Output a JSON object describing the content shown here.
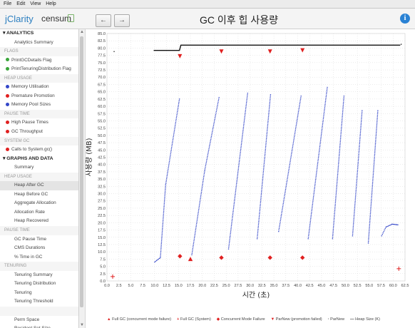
{
  "menu": [
    "File",
    "Edit",
    "View",
    "Help"
  ],
  "brand": {
    "left": "jClarity",
    "right": "censum"
  },
  "nav": {
    "back": "←",
    "forward": "→"
  },
  "title": "GC 이후 힙 사용량",
  "info_icon": "i",
  "colors": {
    "accent": "#2c7fc0",
    "red": "#e02020",
    "blue": "#3346c8",
    "green": "#3aa53a"
  },
  "sidebar": [
    {
      "kind": "section",
      "label": "▾ ANALYTICS"
    },
    {
      "kind": "item",
      "label": "Analytics Summary"
    },
    {
      "kind": "group",
      "label": "FLAGS"
    },
    {
      "kind": "check",
      "label": "PrintGCDetails Flag",
      "status": "green"
    },
    {
      "kind": "check",
      "label": "PrintTenuringDistribution Flag",
      "status": "green"
    },
    {
      "kind": "group",
      "label": "HEAP USAGE"
    },
    {
      "kind": "check",
      "label": "Memory Utilisation",
      "status": "blue"
    },
    {
      "kind": "check",
      "label": "Premature Promotion",
      "status": "red"
    },
    {
      "kind": "check",
      "label": "Memory Pool Sizes",
      "status": "blue"
    },
    {
      "kind": "group",
      "label": "PAUSE TIME"
    },
    {
      "kind": "check",
      "label": "High Pause Times",
      "status": "red"
    },
    {
      "kind": "check",
      "label": "GC Throughput",
      "status": "red"
    },
    {
      "kind": "group",
      "label": "SYSTEM GC"
    },
    {
      "kind": "check",
      "label": "Calls to System.gc()",
      "status": "red"
    },
    {
      "kind": "section",
      "label": "▾ GRAPHS AND DATA"
    },
    {
      "kind": "item",
      "label": "Summary"
    },
    {
      "kind": "group",
      "label": "HEAP USAGE"
    },
    {
      "kind": "item",
      "label": "Heap After GC",
      "active": true
    },
    {
      "kind": "item",
      "label": "Heap Before GC"
    },
    {
      "kind": "item",
      "label": "Aggregate Allocation"
    },
    {
      "kind": "item",
      "label": "Allocation Rate"
    },
    {
      "kind": "item",
      "label": "Heap Recovered"
    },
    {
      "kind": "group",
      "label": "PAUSE TIME"
    },
    {
      "kind": "item",
      "label": "GC Pause Time"
    },
    {
      "kind": "item",
      "label": "CMS Durations"
    },
    {
      "kind": "item",
      "label": "% Time in GC"
    },
    {
      "kind": "group",
      "label": "TENURING"
    },
    {
      "kind": "item",
      "label": "Tenuring Summary"
    },
    {
      "kind": "item",
      "label": "Tenuring Distribution"
    },
    {
      "kind": "item",
      "label": "Tenuring"
    },
    {
      "kind": "item",
      "label": "Tenuring Threshold"
    },
    {
      "kind": "group",
      "label": ""
    },
    {
      "kind": "item",
      "label": "Perm Space"
    },
    {
      "kind": "item",
      "label": "Resident Set Size"
    }
  ],
  "legend": [
    {
      "marker": "▲",
      "text": "Full GC (concurrent mode failure)",
      "color": "red"
    },
    {
      "marker": "+",
      "text": "Full GC (System)",
      "color": "red"
    },
    {
      "marker": "◆",
      "text": "Concurrent Mode Failure",
      "color": "red"
    },
    {
      "marker": "▼",
      "text": "ParNew (promotion failed)",
      "color": "red"
    },
    {
      "marker": "·",
      "text": "ParNew",
      "color": "black"
    },
    {
      "marker": "—",
      "text": "Heap Size (K)",
      "color": "black"
    }
  ],
  "chart_data": {
    "type": "scatter",
    "xlabel": "시간 (초)",
    "ylabel": "사용량 (MB)",
    "xlim": [
      0,
      62.5
    ],
    "ylim": [
      0,
      85
    ],
    "xticks": [
      "0.0",
      "2.5",
      "5.0",
      "7.5",
      "10.0",
      "12.5",
      "15.0",
      "17.5",
      "20.0",
      "22.5",
      "25.0",
      "27.5",
      "30.0",
      "32.5",
      "35.0",
      "37.5",
      "40.0",
      "42.5",
      "45.0",
      "47.5",
      "50.0",
      "52.5",
      "55.0",
      "57.5",
      "60.0",
      "62.5"
    ],
    "yticks": [
      "0.0",
      "2.5",
      "5.0",
      "7.5",
      "10.0",
      "12.5",
      "15.0",
      "17.5",
      "20.0",
      "22.5",
      "25.0",
      "27.5",
      "30.0",
      "32.5",
      "35.0",
      "37.5",
      "40.0",
      "42.5",
      "45.0",
      "47.5",
      "50.0",
      "52.5",
      "55.0",
      "57.5",
      "60.0",
      "62.5",
      "65.0",
      "67.5",
      "70.0",
      "72.5",
      "75.0",
      "77.5",
      "80.0",
      "82.5",
      "85.0"
    ],
    "heap_size_line": [
      [
        9.8,
        79.2
      ],
      [
        15.2,
        79.2
      ],
      [
        15.5,
        81.0
      ],
      [
        61.5,
        81.0
      ]
    ],
    "parnew_segments": [
      [
        10.0,
        6.5,
        11.2,
        8.0
      ],
      [
        11.2,
        8.0,
        12.3,
        33.0
      ],
      [
        12.3,
        33.0,
        15.2,
        62.5
      ],
      [
        17.8,
        9.0,
        20.5,
        38.0
      ],
      [
        20.5,
        38.0,
        23.5,
        63.0
      ],
      [
        25.5,
        11.0,
        29.5,
        64.5
      ],
      [
        31.5,
        14.5,
        34.3,
        64.0
      ],
      [
        36.0,
        17.0,
        40.7,
        63.5
      ],
      [
        42.2,
        14.5,
        46.2,
        66.5
      ],
      [
        47.3,
        14.5,
        49.7,
        63.5
      ],
      [
        51.5,
        15.5,
        53.5,
        58.5
      ],
      [
        54.8,
        13.0,
        56.8,
        58.5
      ],
      [
        57.6,
        15.5,
        58.5,
        18.5
      ],
      [
        58.5,
        18.5,
        59.8,
        19.5
      ],
      [
        59.8,
        19.5,
        61.0,
        19.3
      ]
    ],
    "full_gc_cmf": [
      [
        17.5,
        7.5
      ]
    ],
    "full_gc_system": [
      [
        1.2,
        1.5
      ],
      [
        61.2,
        4.2
      ]
    ],
    "concurrent_mode_failure": [
      [
        15.3,
        8.5
      ],
      [
        24.0,
        8.0
      ],
      [
        34.2,
        8.0
      ],
      [
        41.0,
        8.0
      ]
    ],
    "parnew_promotion_failed": [
      [
        15.3,
        77.2
      ],
      [
        24.0,
        78.8
      ],
      [
        34.2,
        78.8
      ],
      [
        41.0,
        79.2
      ]
    ],
    "stray_points": [
      [
        1.5,
        78.8
      ],
      [
        61.7,
        81.3
      ]
    ]
  }
}
